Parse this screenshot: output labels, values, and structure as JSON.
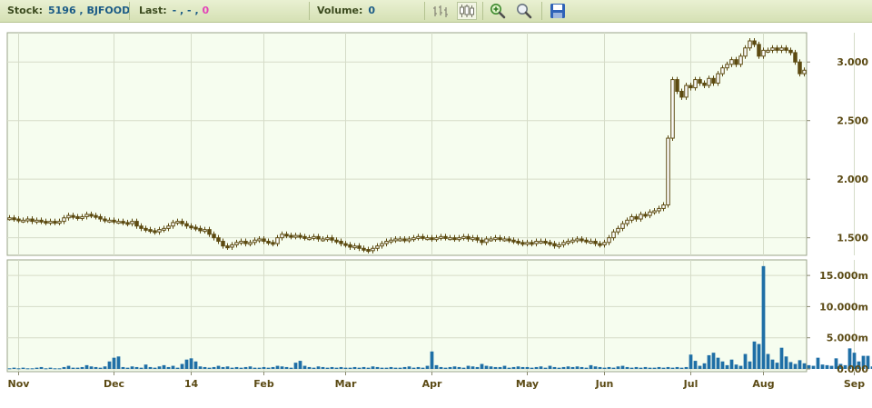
{
  "toolbar": {
    "stock_label": "Stock:",
    "stock_value": "5196 , BJFOOD",
    "last_label": "Last:",
    "last_value": "- , - ,",
    "last_change": "0",
    "volume_label": "Volume:",
    "volume_value": "0",
    "icons": [
      "line-chart-icon",
      "candlestick-icon",
      "zoom-in-icon",
      "zoom-out-icon",
      "save-icon"
    ]
  },
  "colors": {
    "plot_bg": "#f6fdef",
    "grid": "#d5dcc8",
    "candle": "#5c4a10",
    "volume": "#1f6fa6",
    "axis_text": "#5b4a14"
  },
  "chart_data": [
    {
      "type": "candlestick",
      "name": "price",
      "ylim": [
        1.35,
        3.25
      ],
      "yticks": [
        "1.500",
        "2.000",
        "2.500",
        "3.000"
      ],
      "ytick_values": [
        1.5,
        2.0,
        2.5,
        3.0
      ],
      "grid": true,
      "closes": [
        1.67,
        1.66,
        1.65,
        1.65,
        1.66,
        1.64,
        1.65,
        1.64,
        1.63,
        1.64,
        1.63,
        1.64,
        1.67,
        1.69,
        1.68,
        1.67,
        1.68,
        1.7,
        1.69,
        1.68,
        1.66,
        1.65,
        1.65,
        1.64,
        1.64,
        1.63,
        1.62,
        1.64,
        1.6,
        1.58,
        1.57,
        1.56,
        1.55,
        1.57,
        1.58,
        1.6,
        1.63,
        1.64,
        1.62,
        1.6,
        1.59,
        1.58,
        1.56,
        1.57,
        1.53,
        1.5,
        1.47,
        1.43,
        1.42,
        1.44,
        1.46,
        1.47,
        1.45,
        1.46,
        1.48,
        1.49,
        1.47,
        1.46,
        1.45,
        1.5,
        1.53,
        1.52,
        1.51,
        1.52,
        1.51,
        1.5,
        1.5,
        1.51,
        1.49,
        1.49,
        1.5,
        1.48,
        1.47,
        1.45,
        1.44,
        1.42,
        1.43,
        1.41,
        1.4,
        1.39,
        1.41,
        1.43,
        1.45,
        1.47,
        1.48,
        1.49,
        1.49,
        1.48,
        1.49,
        1.5,
        1.51,
        1.5,
        1.5,
        1.49,
        1.5,
        1.51,
        1.5,
        1.5,
        1.49,
        1.5,
        1.51,
        1.49,
        1.5,
        1.48,
        1.46,
        1.49,
        1.49,
        1.5,
        1.49,
        1.49,
        1.48,
        1.47,
        1.46,
        1.45,
        1.46,
        1.45,
        1.47,
        1.47,
        1.46,
        1.45,
        1.43,
        1.44,
        1.46,
        1.47,
        1.48,
        1.49,
        1.48,
        1.47,
        1.47,
        1.45,
        1.44,
        1.46,
        1.5,
        1.55,
        1.58,
        1.62,
        1.65,
        1.68,
        1.66,
        1.7,
        1.69,
        1.72,
        1.73,
        1.75,
        1.78,
        2.35,
        2.85,
        2.75,
        2.7,
        2.8,
        2.78,
        2.85,
        2.82,
        2.8,
        2.86,
        2.82,
        2.9,
        2.95,
        2.98,
        3.02,
        2.98,
        3.05,
        3.12,
        3.18,
        3.15,
        3.05,
        3.1,
        3.1,
        3.12,
        3.1,
        3.12,
        3.1,
        3.08,
        3.0,
        2.9,
        2.93
      ]
    },
    {
      "type": "bar",
      "name": "volume",
      "ylim": [
        0,
        17.5
      ],
      "yticks": [
        "0.000",
        "5.000m",
        "10.000m",
        "15.000m"
      ],
      "ytick_values": [
        0,
        5,
        10,
        15
      ],
      "grid": true,
      "x_categories": [
        "Nov",
        "Dec",
        "14",
        "Feb",
        "Mar",
        "Apr",
        "May",
        "Jun",
        "Jul",
        "Aug",
        "Sep"
      ],
      "x_category_start_index": [
        2,
        23,
        40,
        56,
        74,
        93,
        114,
        131,
        150,
        166,
        186
      ],
      "values": [
        0.1,
        0.2,
        0.1,
        0.2,
        0.1,
        0.1,
        0.2,
        0.3,
        0.1,
        0.2,
        0.1,
        0.1,
        0.3,
        0.5,
        0.2,
        0.2,
        0.3,
        0.6,
        0.4,
        0.3,
        0.2,
        0.4,
        1.2,
        1.8,
        2.0,
        0.3,
        0.2,
        0.4,
        0.3,
        0.2,
        0.7,
        0.3,
        0.2,
        0.4,
        0.6,
        0.3,
        0.5,
        0.2,
        0.8,
        1.5,
        1.7,
        1.2,
        0.4,
        0.3,
        0.2,
        0.3,
        0.5,
        0.3,
        0.4,
        0.2,
        0.3,
        0.2,
        0.3,
        0.4,
        0.2,
        0.2,
        0.3,
        0.2,
        0.3,
        0.5,
        0.4,
        0.3,
        0.2,
        1.0,
        1.3,
        0.5,
        0.3,
        0.2,
        0.4,
        0.3,
        0.2,
        0.3,
        0.2,
        0.3,
        0.2,
        0.2,
        0.3,
        0.2,
        0.3,
        0.2,
        0.4,
        0.3,
        0.2,
        0.2,
        0.3,
        0.2,
        0.2,
        0.3,
        0.4,
        0.2,
        0.3,
        0.2,
        0.5,
        2.8,
        0.6,
        0.3,
        0.2,
        0.3,
        0.4,
        0.3,
        0.2,
        0.5,
        0.4,
        0.3,
        0.8,
        0.5,
        0.4,
        0.3,
        0.3,
        0.5,
        0.2,
        0.3,
        0.4,
        0.3,
        0.3,
        0.2,
        0.3,
        0.4,
        0.2,
        0.5,
        0.3,
        0.2,
        0.3,
        0.4,
        0.3,
        0.4,
        0.3,
        0.2,
        0.6,
        0.4,
        0.3,
        0.2,
        0.3,
        0.2,
        0.4,
        0.5,
        0.3,
        0.2,
        0.3,
        0.2,
        0.3,
        0.2,
        0.2,
        0.3,
        0.2,
        0.3,
        0.2,
        0.3,
        0.2,
        0.3,
        2.3,
        1.3,
        0.5,
        0.9,
        2.2,
        2.6,
        1.8,
        1.2,
        0.6,
        1.5,
        0.7,
        0.5,
        2.4,
        1.2,
        4.4,
        4.0,
        16.5,
        2.4,
        1.5,
        1.0,
        3.4,
        2.0,
        1.1,
        0.8,
        1.4,
        0.9,
        0.6,
        0.5,
        1.8,
        0.7,
        0.6,
        0.5,
        1.7,
        0.8,
        0.6,
        3.3,
        2.6,
        1.2,
        2.1,
        2.1,
        0.4,
        0.3,
        0.2,
        0.6,
        1.6,
        0.4,
        1.1,
        0.5,
        0.3,
        0.2,
        0.4,
        1.3,
        0.3,
        0.2,
        0.2,
        0.3
      ]
    }
  ]
}
